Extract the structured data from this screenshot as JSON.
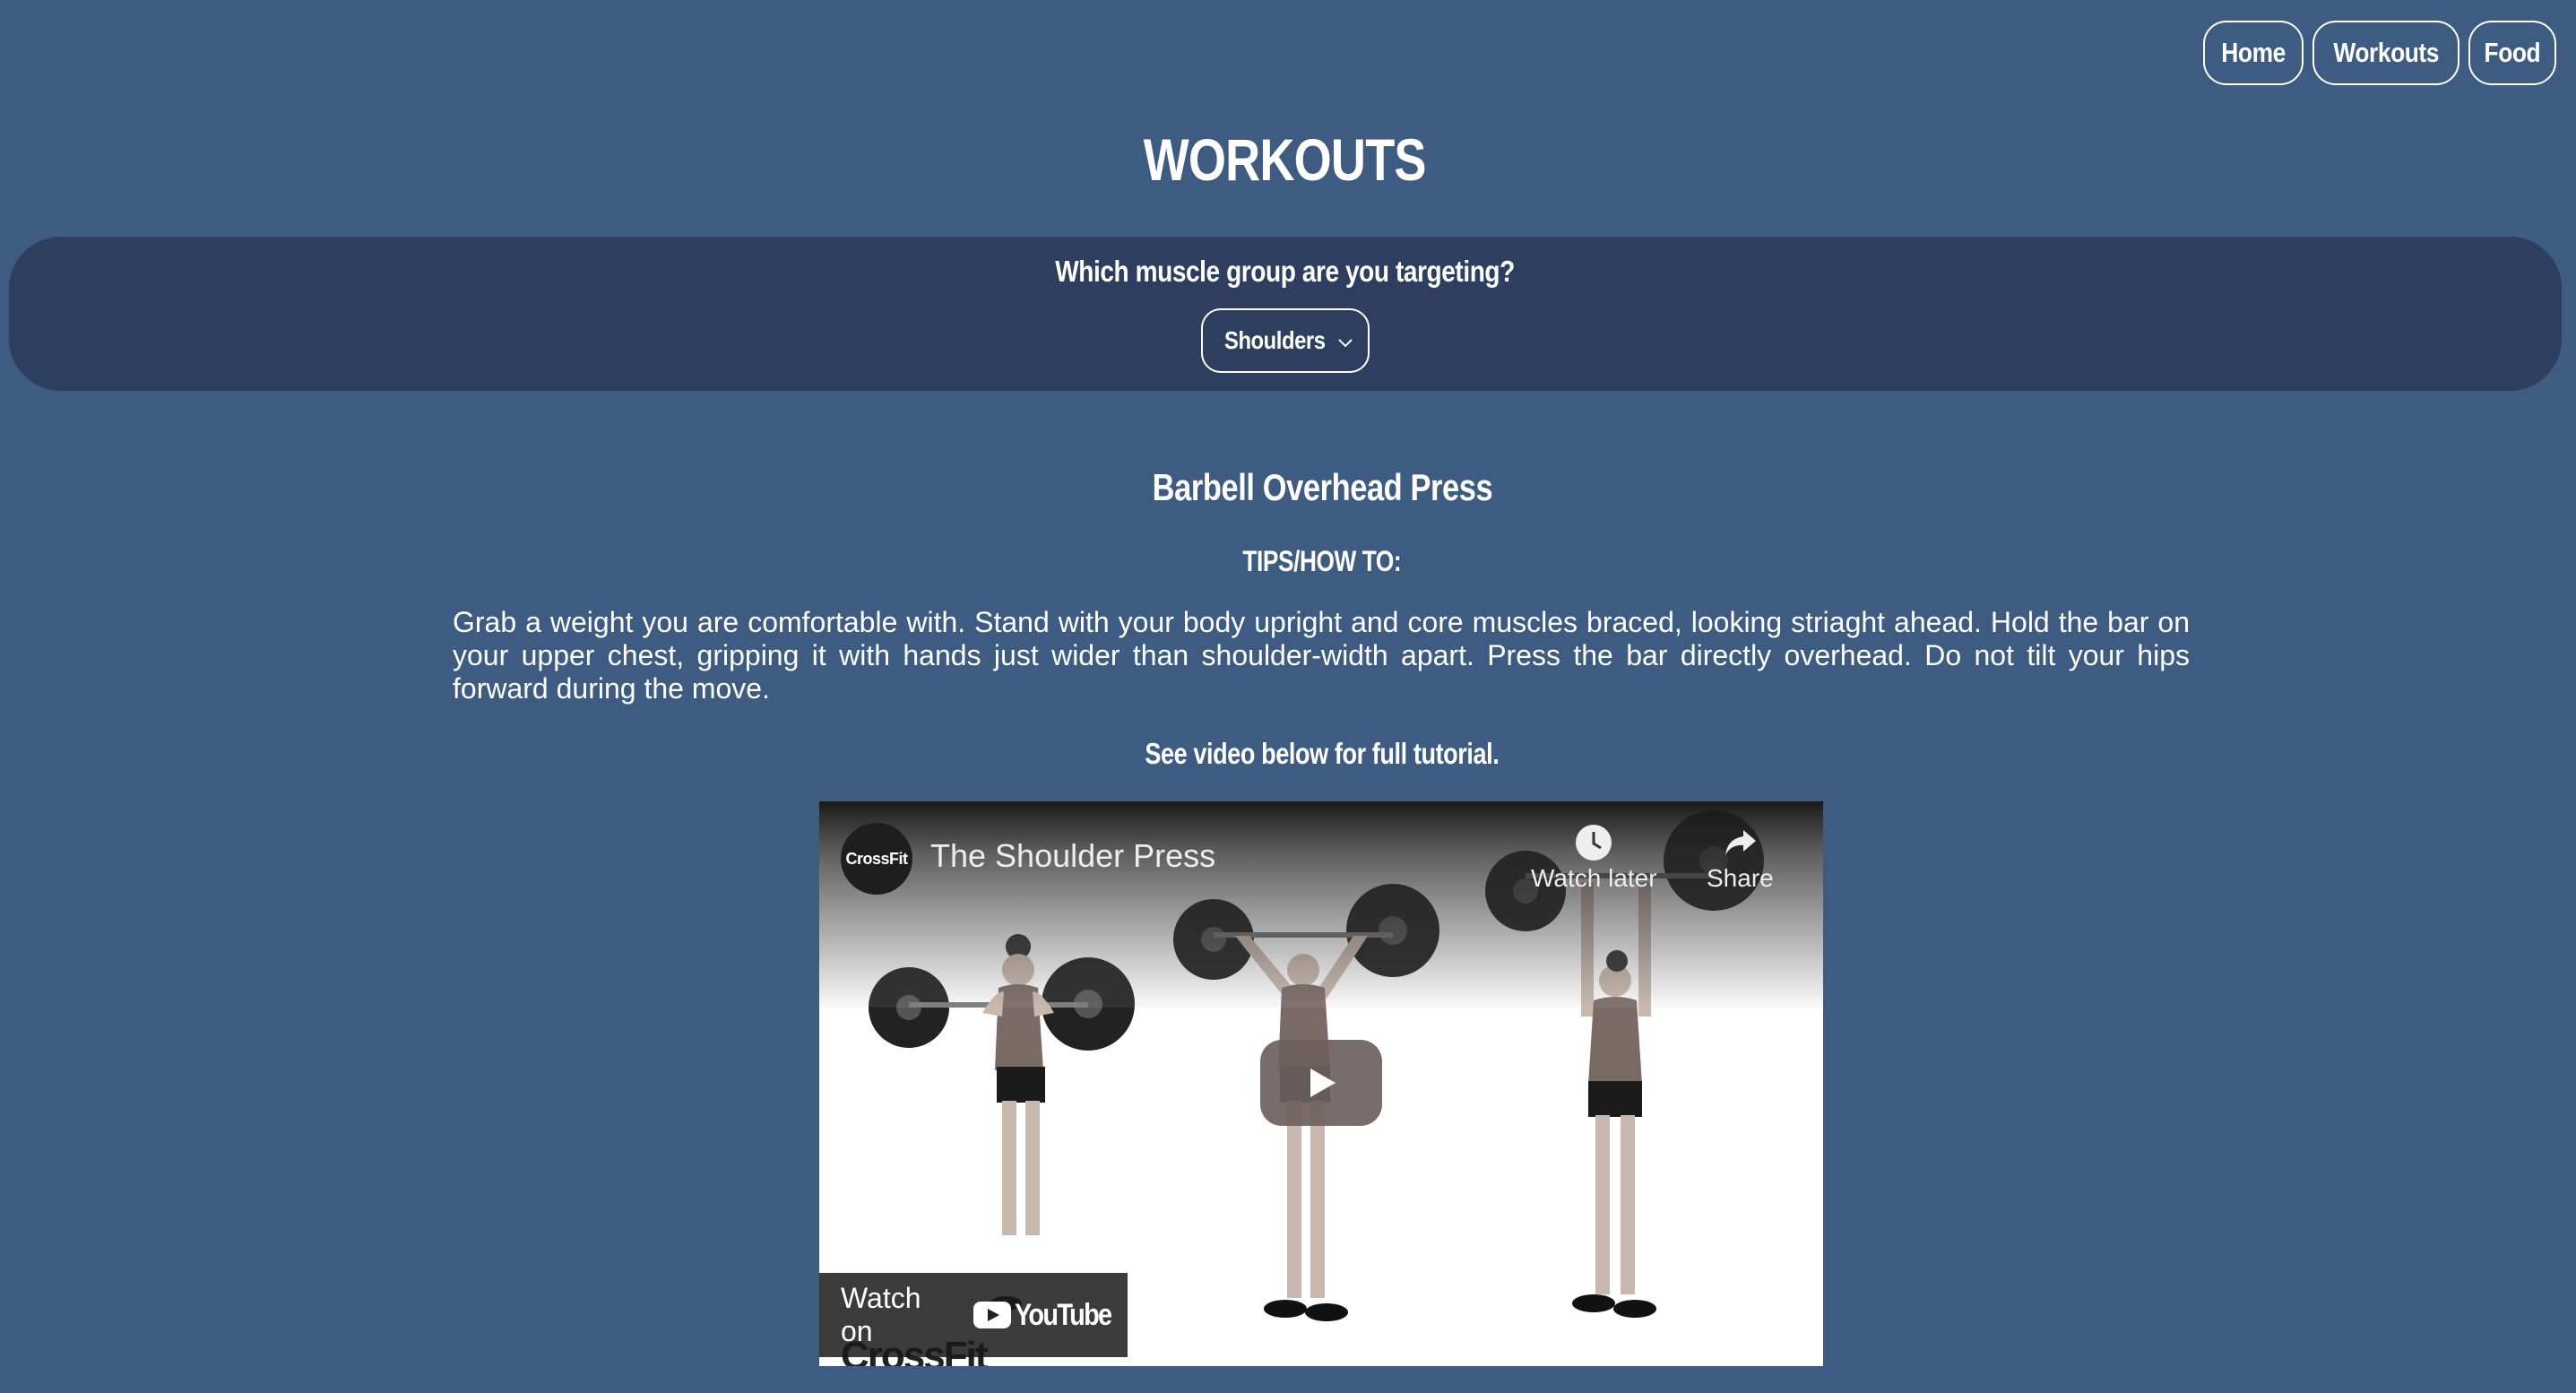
{
  "nav": {
    "home": "Home",
    "workouts": "Workouts",
    "food": "Food"
  },
  "page": {
    "title": "WORKOUTS"
  },
  "filter": {
    "question": "Which muscle group are you targeting?",
    "selected": "Shoulders"
  },
  "exercise": {
    "name": "Barbell Overhead Press",
    "tips_heading": "TIPS/HOW TO:",
    "tips": "Grab a weight you are comfortable with. Stand with your body upright and core muscles braced, looking striaght ahead. Hold the bar on your upper chest, gripping it with hands just wider than shoulder-width apart. Press the bar directly overhead. Do not tilt your hips forward during the move.",
    "video_note": "See video below for full tutorial."
  },
  "video": {
    "channel": "CrossFit",
    "title": "The Shoulder Press",
    "watch_later": "Watch later",
    "share": "Share",
    "watch_on": "Watch on",
    "youtube": "YouTube",
    "footer_brand": "CrossFit"
  },
  "colors": {
    "background": "#3e5b81",
    "panel": "#2d3e5e",
    "text": "#ffffff"
  }
}
